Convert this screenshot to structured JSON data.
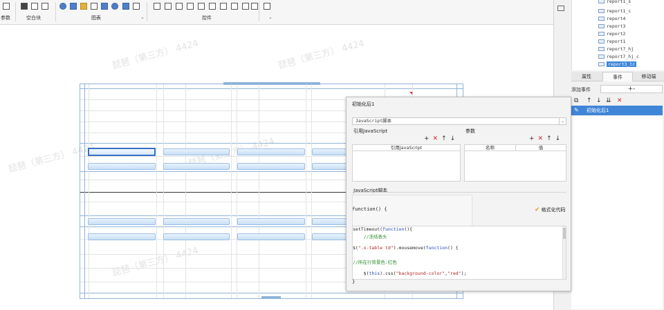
{
  "ribbon": {
    "groups": {
      "left": "参数",
      "blank": "空白块",
      "chart": "图表",
      "widget": "控件"
    },
    "carets": {
      "chart": "⌄",
      "widget": "⌄"
    }
  },
  "watermark": "琵琶（第三方） 4424",
  "right_panel": {
    "datasets": [
      {
        "label": "report1_s"
      },
      {
        "label": "report1_c"
      },
      {
        "label": "report4"
      },
      {
        "label": "report3"
      },
      {
        "label": "report2"
      },
      {
        "label": "report1"
      },
      {
        "label": "report7_hj"
      },
      {
        "label": "report7_hj_c"
      },
      {
        "label": "report3_tc",
        "selected": true
      }
    ],
    "tabs": {
      "attributes": "属性",
      "events": "事件",
      "mobile": "移动端"
    },
    "add_event_label": "添加事件",
    "add_event_button": "+-",
    "toolbar": {
      "copy": "⧉",
      "up": "↑",
      "down": "↓",
      "sort": "⇊",
      "delete": "✕"
    },
    "events": [
      {
        "label": "初始化后1"
      }
    ]
  },
  "dialog": {
    "title": "初始化后1",
    "script_type": "JavaScript脚本",
    "select_arrow": "⌄",
    "ref_js_label": "引用JavaScript",
    "params_label": "参数",
    "mini_toolbar": {
      "add": "+",
      "delete": "✕",
      "up": "↑",
      "down": "↓"
    },
    "ref_js_col": "引用JavaScript",
    "param_name_col": "名称",
    "param_value_col": "值",
    "js_script_label": "JavaScript脚本",
    "function_sig": "function() {",
    "format_button": "格式化代码",
    "format_check": "✔",
    "code": {
      "l1_kw": "setTimeout(",
      "l1_fn": "function",
      "l1_rest": "(){",
      "l2": "    //冻结表头",
      "l3_a": "$(",
      "l3_str": "\".x-table td\"",
      "l3_b": ").mousemove(",
      "l3_fn": "function",
      "l3_c": "() {",
      "l4": "//所在行背景色:红色",
      "l5_a": "    $(",
      "l5_this": "this",
      "l5_b": ").css(",
      "l5_s1": "\"background-color\"",
      "l5_comma": ",",
      "l5_s2": "\"red\"",
      "l5_c": ");"
    },
    "closing_brace": "}"
  }
}
